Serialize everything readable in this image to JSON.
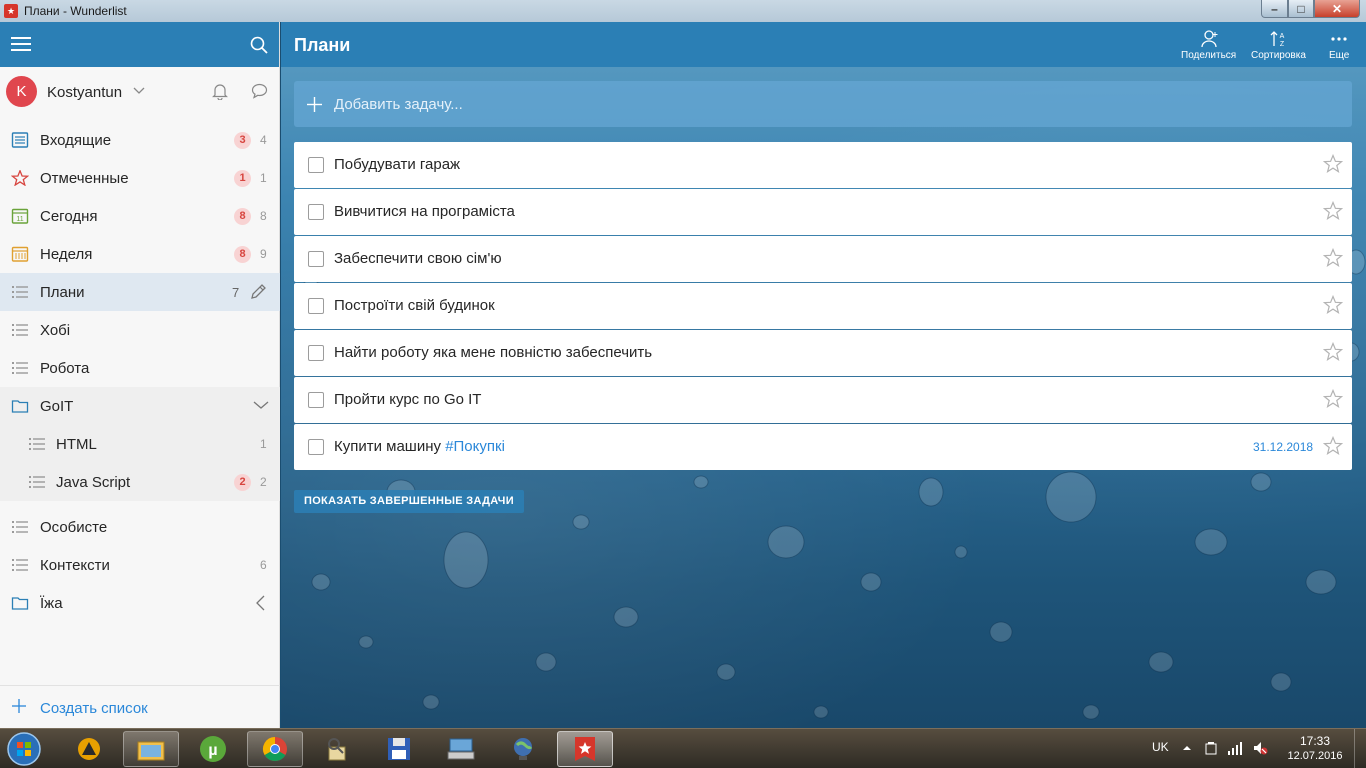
{
  "window": {
    "title": "Плани - Wunderlist"
  },
  "user": {
    "initial": "K",
    "name": "Kostyantun"
  },
  "sidebar": {
    "items": [
      {
        "label": "Входящие",
        "badge": "3",
        "count": "4"
      },
      {
        "label": "Отмеченные",
        "badge": "1",
        "count": "1"
      },
      {
        "label": "Сегодня",
        "badge": "8",
        "count": "8"
      },
      {
        "label": "Неделя",
        "badge": "8",
        "count": "9"
      },
      {
        "label": "Плани",
        "count": "7"
      },
      {
        "label": "Хобі"
      },
      {
        "label": "Робота"
      },
      {
        "label": "GoIT"
      },
      {
        "label": "HTML",
        "count": "1"
      },
      {
        "label": "Java Script",
        "badge": "2",
        "count": "2"
      },
      {
        "label": "Особисте"
      },
      {
        "label": "Контексти",
        "count": "6"
      },
      {
        "label": "Їжа"
      }
    ],
    "create_list": "Создать список"
  },
  "main": {
    "title": "Плани",
    "actions": {
      "share": "Поделиться",
      "sort": "Сортировка",
      "more": "Еще"
    },
    "add_placeholder": "Добавить задачу...",
    "tasks": [
      {
        "text": "Побудувати гараж"
      },
      {
        "text": "Вивчитися на програміста"
      },
      {
        "text": "Забеспечити свою сім'ю"
      },
      {
        "text": "Построїти свій будинок"
      },
      {
        "text": "Найти роботу яка мене повністю забеспечить"
      },
      {
        "text": "Пройти курс по Go IT"
      },
      {
        "text": "Купити машину",
        "tag": "#Покупкі",
        "due": "31.12.2018"
      }
    ],
    "show_completed": "ПОКАЗАТЬ ЗАВЕРШЕННЫЕ ЗАДАЧИ"
  },
  "taskbar": {
    "lang": "UK",
    "time": "17:33",
    "date": "12.07.2016"
  },
  "colors": {
    "accent": "#2b7fb5",
    "badge_bg": "#f8d3d3",
    "badge_text": "#d7453f",
    "link": "#2b88d9"
  }
}
